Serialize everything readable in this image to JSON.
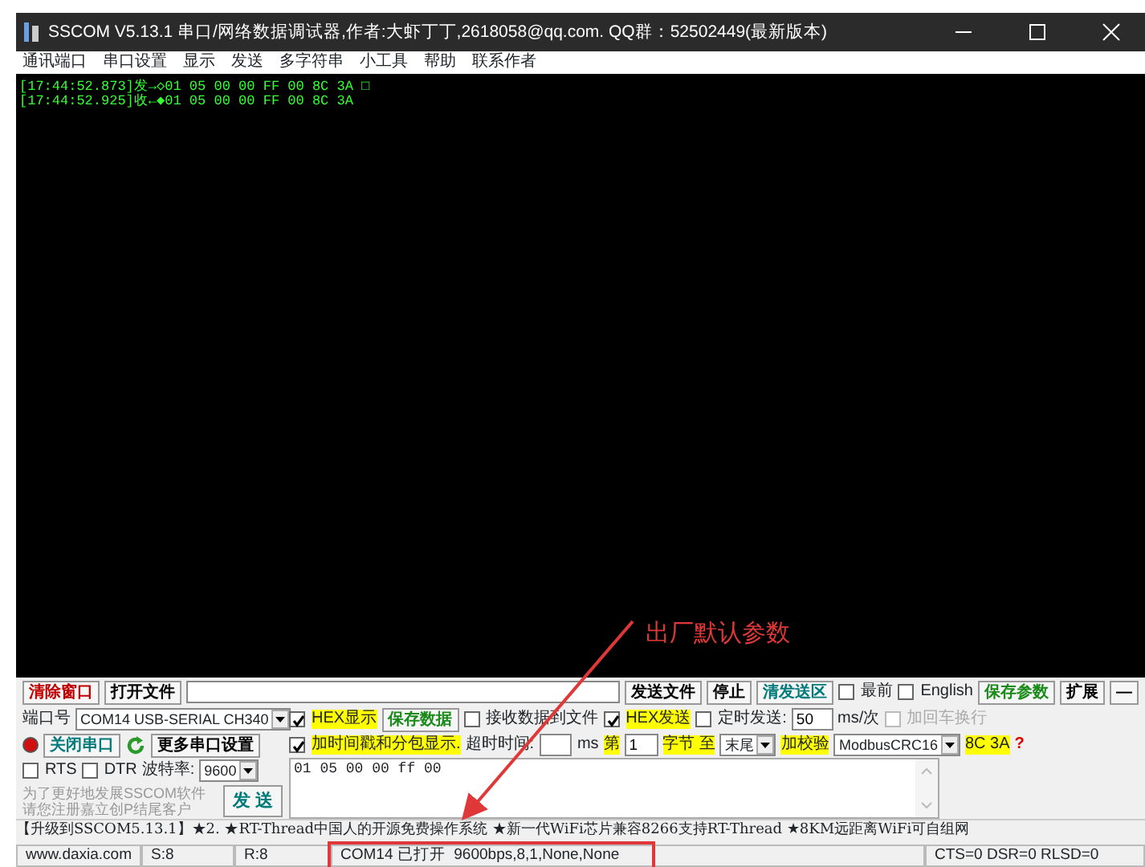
{
  "window": {
    "title": "SSCOM V5.13.1 串口/网络数据调试器,作者:大虾丁丁,2618058@qq.com. QQ群：52502449(最新版本)"
  },
  "menu": [
    "通讯端口",
    "串口设置",
    "显示",
    "发送",
    "多字符串",
    "小工具",
    "帮助",
    "联系作者"
  ],
  "receive_lines": [
    "[17:44:52.873]发→◇01 05 00 00 FF 00 8C 3A □",
    "[17:44:52.925]收←◆01 05 00 00 FF 00 8C 3A"
  ],
  "toolbar": [
    {
      "kind": "button",
      "label": "清除窗口",
      "color": "#c00000"
    },
    {
      "kind": "button",
      "label": "打开文件"
    },
    {
      "kind": "grow-field"
    },
    {
      "kind": "button",
      "label": "发送文件"
    },
    {
      "kind": "button",
      "label": "停止"
    },
    {
      "kind": "button",
      "label": "清发送区",
      "color": "#007a7a"
    },
    {
      "kind": "checkbox",
      "label": "最前",
      "checked": false,
      "highlighted": false,
      "disabled": false
    },
    {
      "kind": "checkbox",
      "label": "English",
      "checked": false,
      "highlighted": false,
      "disabled": false
    },
    {
      "kind": "button",
      "label": "保存参数",
      "color": "#1a8a1a"
    },
    {
      "kind": "button",
      "label": "扩展"
    },
    {
      "kind": "button",
      "label": "—"
    }
  ],
  "left_rows": [
    [
      {
        "kind": "text",
        "text": "端口号"
      },
      {
        "kind": "select",
        "value": "COM14 USB-SERIAL CH340"
      }
    ],
    [
      {
        "kind": "led",
        "on": true
      },
      {
        "kind": "button",
        "label": "关闭串口",
        "color": "#007a7a"
      },
      {
        "kind": "refresh"
      },
      {
        "kind": "button",
        "label": "更多串口设置"
      }
    ],
    [
      {
        "kind": "checkbox",
        "label": "RTS",
        "checked": false,
        "highlighted": false,
        "disabled": false
      },
      {
        "kind": "checkbox",
        "label": "DTR",
        "checked": false,
        "highlighted": false,
        "disabled": false
      },
      {
        "kind": "text",
        "text": "波特率:"
      },
      {
        "kind": "select",
        "value": "9600"
      }
    ],
    [
      {
        "kind": "note",
        "lines": [
          "为了更好地发展SSCOM软件",
          "请您注册嘉立创P结尾客户"
        ]
      },
      {
        "kind": "send",
        "label": "发 送"
      }
    ]
  ],
  "right_rows": [
    [
      {
        "kind": "checkbox",
        "label": "HEX显示",
        "checked": true,
        "highlighted": true,
        "disabled": false
      },
      {
        "kind": "button",
        "label": "保存数据",
        "color": "#1a8a1a"
      },
      {
        "kind": "checkbox",
        "label": "接收数据到文件",
        "checked": false,
        "highlighted": false,
        "disabled": false
      },
      {
        "kind": "checkbox",
        "label": "HEX发送",
        "checked": true,
        "highlighted": true,
        "disabled": false
      },
      {
        "kind": "checkbox",
        "label": "定时发送:",
        "checked": false,
        "highlighted": false,
        "disabled": false
      },
      {
        "kind": "field",
        "value": "50"
      },
      {
        "kind": "text",
        "text": "ms/次"
      },
      {
        "kind": "checkbox",
        "label": "加回车换行",
        "checked": false,
        "highlighted": false,
        "disabled": true
      }
    ],
    [
      {
        "kind": "checkbox",
        "label": "加时间戳和分包显示.",
        "checked": true,
        "highlighted": true,
        "disabled": false
      },
      {
        "kind": "text",
        "text": "超时时间:"
      },
      {
        "kind": "field"
      },
      {
        "kind": "text",
        "text": "ms"
      },
      {
        "kind": "mark",
        "text": "第"
      },
      {
        "kind": "field",
        "value": "1"
      },
      {
        "kind": "mark",
        "text": "字节 至"
      },
      {
        "kind": "select",
        "value": "末尾"
      },
      {
        "kind": "mark",
        "text": "加校验"
      },
      {
        "kind": "select",
        "value": "ModbusCRC16"
      },
      {
        "kind": "mark",
        "text": "8C 3A"
      },
      {
        "kind": "help",
        "text": "?"
      }
    ]
  ],
  "send_text": "01 05 00 00 ff 00",
  "ticker": "【升级到SSCOM5.13.1】★2. ★RT-Thread中国人的开源免费操作系统 ★新一代WiFi芯片兼容8266支持RT-Thread ★8KM远距离WiFi可自组网",
  "status_bar": [
    "www.daxia.com",
    "S:8",
    "R:8",
    "COM14 已打开  9600bps,8,1,None,None",
    "CTS=0 DSR=0 RLSD=0"
  ],
  "annotation": {
    "text": "出厂默认参数"
  }
}
